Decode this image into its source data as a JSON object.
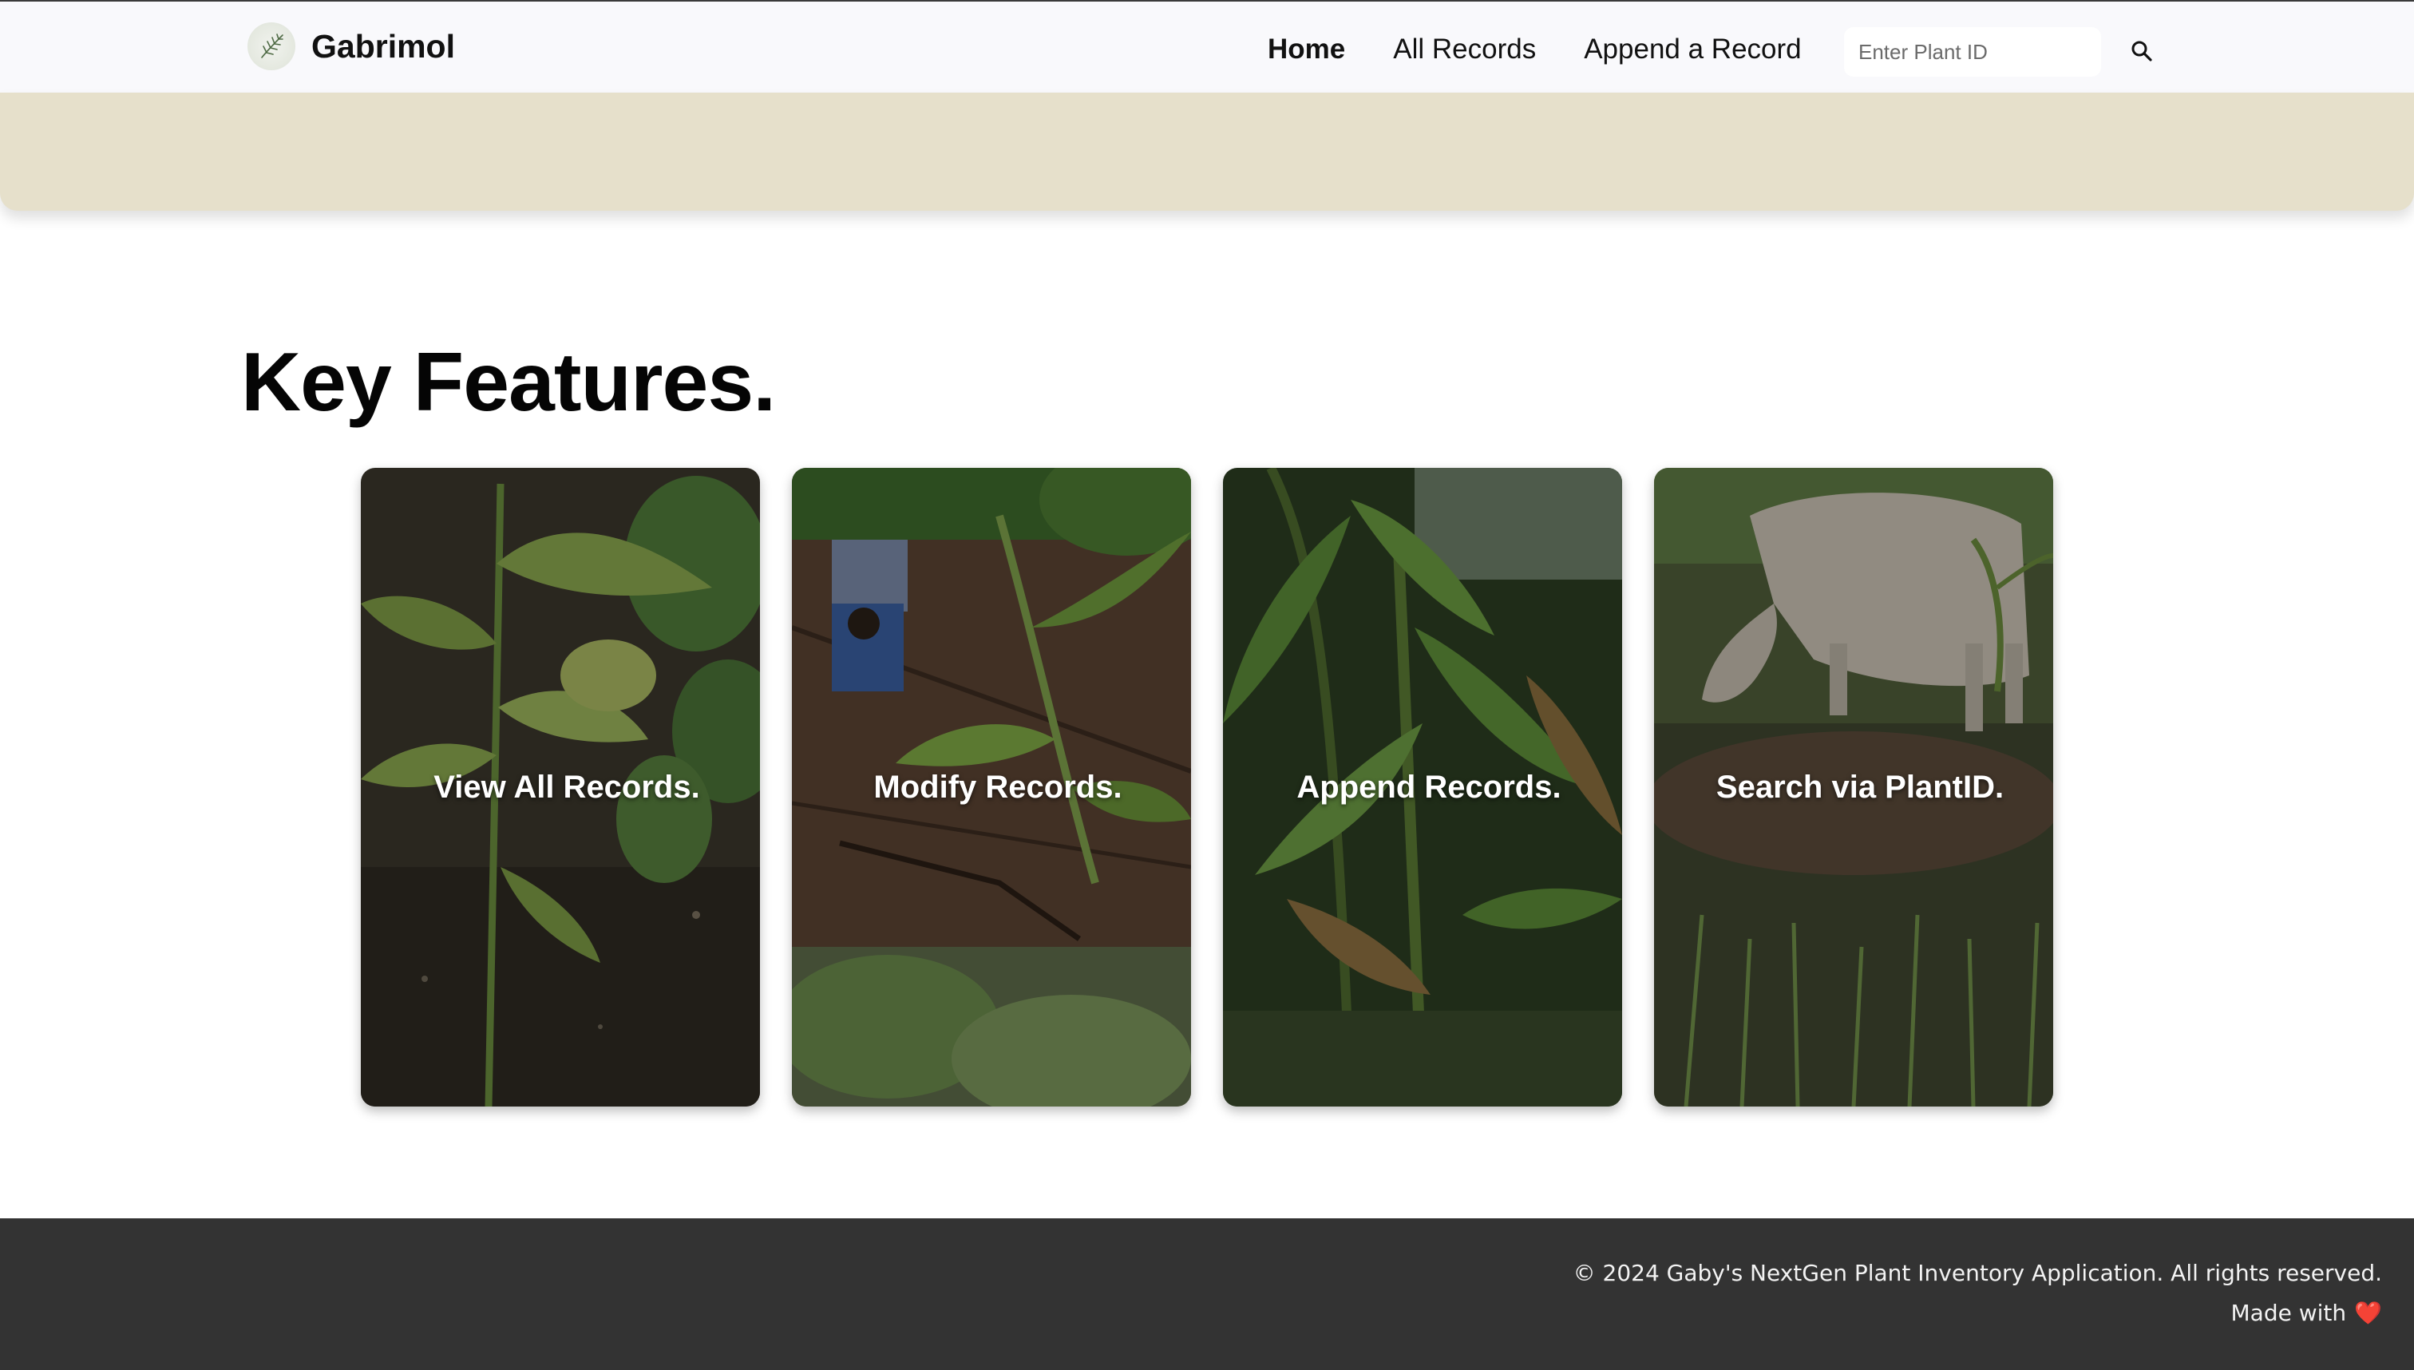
{
  "navbar": {
    "brand_name": "Gabrimol",
    "links": [
      {
        "label": "Home",
        "active": true
      },
      {
        "label": "All Records",
        "active": false
      },
      {
        "label": "Append a Record",
        "active": false
      }
    ],
    "search_placeholder": "Enter Plant ID",
    "search_icon": "search-icon",
    "logo_icon": "leaf-logo-icon"
  },
  "main": {
    "section_title": "Key Features.",
    "cards": [
      {
        "label": "View All Records.",
        "image": "plant-seedling-photo"
      },
      {
        "label": "Modify Records.",
        "image": "farmer-digging-photo"
      },
      {
        "label": "Append Records.",
        "image": "banana-plants-photo"
      },
      {
        "label": "Search via PlantID.",
        "image": "grazing-cow-photo"
      }
    ]
  },
  "footer": {
    "copyright": "© 2024 Gaby's NextGen Plant Inventory Application. All rights reserved.",
    "made_with": "Made with",
    "heart": "❤️"
  },
  "colors": {
    "navbar_bg": "#f9f9fc",
    "hero_bg": "#e6e0cb",
    "footer_bg": "#333333",
    "heart": "#e0232c"
  }
}
